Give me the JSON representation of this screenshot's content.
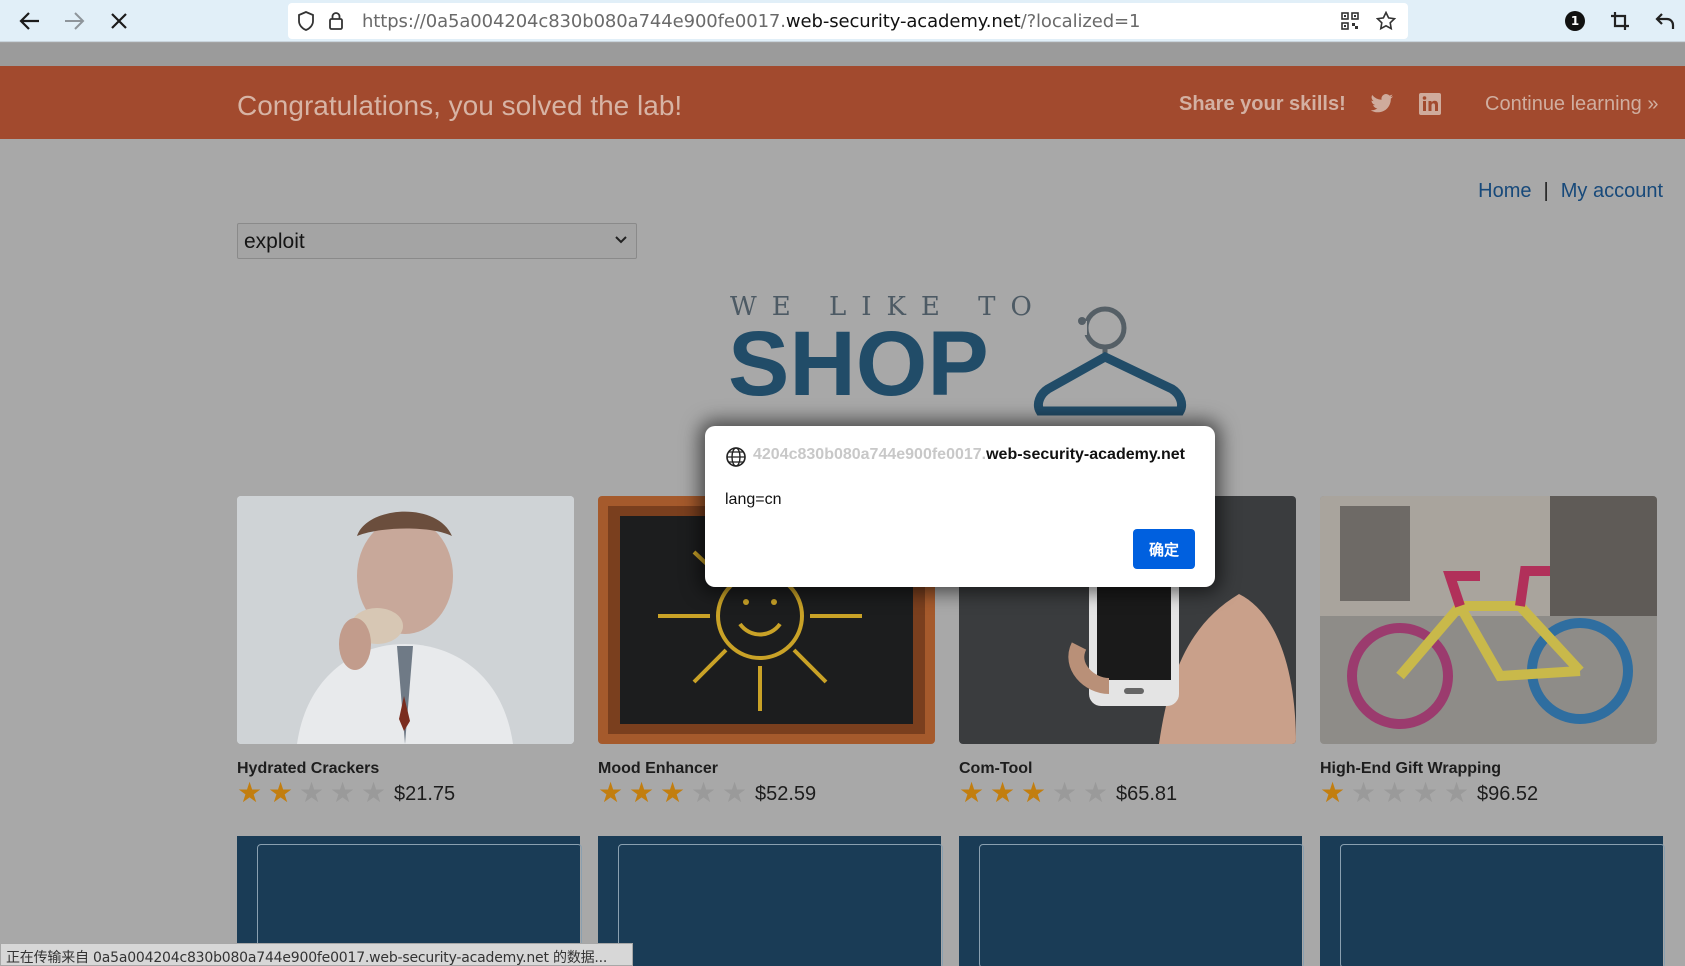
{
  "browser": {
    "url_prefix": "https://0a5a004204c830b080a744e900fe0017.",
    "url_domain": "web-security-academy.net",
    "url_suffix": "/?localized=1",
    "extension_badge": "1"
  },
  "banner": {
    "title": "Congratulations, you solved the lab!",
    "share_label": "Share your skills!",
    "continue_label": "Continue learning",
    "continue_icon": "»"
  },
  "nav": {
    "home": "Home",
    "separator": "|",
    "account": "My account"
  },
  "language_select": {
    "selected": "exploit"
  },
  "logo": {
    "top_text": "WE LIKE TO",
    "main_text": "SHOP"
  },
  "products": [
    {
      "name": "Hydrated Crackers",
      "price": "$21.75",
      "rating": 2
    },
    {
      "name": "Mood Enhancer",
      "price": "$52.59",
      "rating": 3
    },
    {
      "name": "Com-Tool",
      "price": "$65.81",
      "rating": 3
    },
    {
      "name": "High-End Gift Wrapping",
      "price": "$96.52",
      "rating": 1
    }
  ],
  "dialog": {
    "origin_faded": "4204c830b080a744e900fe0017.",
    "origin": "web-security-academy.net",
    "message": "lang=cn",
    "ok_label": "确定"
  },
  "status_bar": {
    "text": "正在传输来自 0a5a004204c830b080a744e900fe0017.web-security-academy.net 的数据..."
  },
  "colors": {
    "banner": "#a24a2e",
    "button_blue": "#0060df",
    "star_on": "#c27e0f",
    "view_button": "#1a3c56"
  }
}
